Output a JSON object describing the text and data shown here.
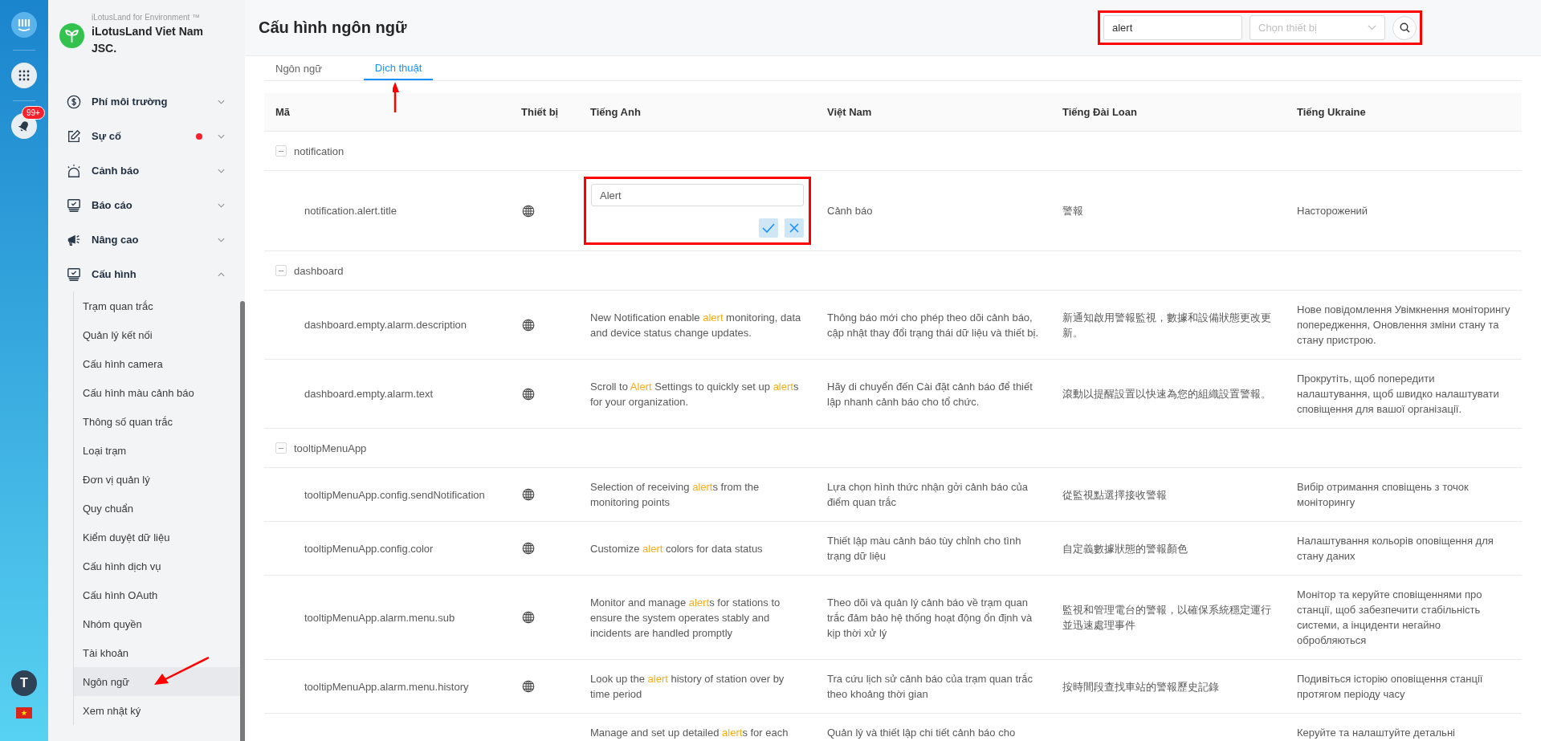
{
  "rail": {
    "notification_count": "99+",
    "avatar_letter": "T"
  },
  "brand": {
    "tagline": "iLotusLand for Environment ™",
    "name": "iLotusLand Viet Nam JSC."
  },
  "sidebar": {
    "items": [
      {
        "label": "Phí môi trường",
        "expanded": false,
        "has_alert": false
      },
      {
        "label": "Sự cố",
        "expanded": false,
        "has_alert": true
      },
      {
        "label": "Cảnh báo",
        "expanded": false,
        "has_alert": false
      },
      {
        "label": "Báo cáo",
        "expanded": false,
        "has_alert": false
      },
      {
        "label": "Nâng cao",
        "expanded": false,
        "has_alert": false
      },
      {
        "label": "Cấu hình",
        "expanded": true,
        "has_alert": false,
        "children": [
          {
            "label": "Trạm quan trắc",
            "selected": false,
            "annotated": false
          },
          {
            "label": "Quản lý kết nối",
            "selected": false,
            "annotated": false
          },
          {
            "label": "Cấu hình camera",
            "selected": false,
            "annotated": false
          },
          {
            "label": "Cấu hình màu cảnh báo",
            "selected": false,
            "annotated": false
          },
          {
            "label": "Thông số quan trắc",
            "selected": false,
            "annotated": false
          },
          {
            "label": "Loại trạm",
            "selected": false,
            "annotated": false
          },
          {
            "label": "Đơn vị quản lý",
            "selected": false,
            "annotated": false
          },
          {
            "label": "Quy chuẩn",
            "selected": false,
            "annotated": false
          },
          {
            "label": "Kiểm duyệt dữ liệu",
            "selected": false,
            "annotated": false
          },
          {
            "label": "Cấu hình dịch vụ",
            "selected": false,
            "annotated": false
          },
          {
            "label": "Cấu hình OAuth",
            "selected": false,
            "annotated": false
          },
          {
            "label": "Nhóm quyền",
            "selected": false,
            "annotated": false
          },
          {
            "label": "Tài khoản",
            "selected": false,
            "annotated": false
          },
          {
            "label": "Ngôn ngữ",
            "selected": true,
            "annotated": true
          },
          {
            "label": "Xem nhật ký",
            "selected": false,
            "annotated": false
          }
        ]
      }
    ]
  },
  "page": {
    "title": "Cấu hình ngôn ngữ"
  },
  "filters": {
    "annotated": true,
    "search": {
      "value": "alert"
    },
    "device": {
      "placeholder": "Chọn thiết bị"
    }
  },
  "tabs": [
    {
      "label": "Ngôn ngữ",
      "selected": false,
      "annotated": false
    },
    {
      "label": "Dịch thuật",
      "selected": true,
      "annotated": true
    }
  ],
  "table": {
    "columns": [
      "Mã",
      "Thiết bị",
      "Tiếng Anh",
      "Việt Nam",
      "Tiếng Đài Loan",
      "Tiếng Ukraine"
    ],
    "groups": [
      {
        "name": "notification",
        "expanded": true,
        "children": [
          {
            "key": "notification.alert.title",
            "editing": true,
            "annotated": true,
            "value": "Alert",
            "vietnamese": "Cảnh báo",
            "taiwanese": "警報",
            "ukrainian": "Насторожений"
          }
        ]
      },
      {
        "name": "dashboard",
        "expanded": true,
        "children": [
          {
            "key": "dashboard.empty.alarm.description",
            "editing": false,
            "english": [
              {
                "text": "New Notification enable ",
                "highlight": false
              },
              {
                "text": "alert",
                "highlight": true
              },
              {
                "text": " monitoring, data and device status change updates.",
                "highlight": false
              }
            ],
            "vietnamese": "Thông báo mới cho phép theo dõi cảnh báo, cập nhật thay đổi trạng thái dữ liệu và thiết bị.",
            "taiwanese": "新通知啟用警報監視，數據和設備狀態更改更新。",
            "ukrainian": "Нове повідомлення Увімкнення моніторингу попередження, Оновлення зміни стану та стану пристрою."
          },
          {
            "key": "dashboard.empty.alarm.text",
            "editing": false,
            "english": [
              {
                "text": "Scroll to ",
                "highlight": false
              },
              {
                "text": "Alert",
                "highlight": true
              },
              {
                "text": " Settings to quickly set up ",
                "highlight": false
              },
              {
                "text": "alert",
                "highlight": true
              },
              {
                "text": "s for your organization.",
                "highlight": false
              }
            ],
            "vietnamese": "Hãy di chuyển đến Cài đặt cảnh báo để thiết lập nhanh cảnh báo cho tổ chức.",
            "taiwanese": "滾動以提醒設置以快速為您的組織設置警報。",
            "ukrainian": "Прокрутіть, щоб попередити налаштування, щоб швидко налаштувати сповіщення для вашої організації."
          }
        ]
      },
      {
        "name": "tooltipMenuApp",
        "expanded": true,
        "children": [
          {
            "key": "tooltipMenuApp.config.sendNotification",
            "editing": false,
            "english": [
              {
                "text": "Selection of receiving ",
                "highlight": false
              },
              {
                "text": "alert",
                "highlight": true
              },
              {
                "text": "s from the monitoring points",
                "highlight": false
              }
            ],
            "vietnamese": "Lựa chọn hình thức nhận gởi cảnh báo của điểm quan trắc",
            "taiwanese": "從監視點選擇接收警報",
            "ukrainian": "Вибір отримання сповіщень з точок моніторингу"
          },
          {
            "key": "tooltipMenuApp.config.color",
            "editing": false,
            "english": [
              {
                "text": "Customize ",
                "highlight": false
              },
              {
                "text": "alert",
                "highlight": true
              },
              {
                "text": " colors for data status",
                "highlight": false
              }
            ],
            "vietnamese": "Thiết lập màu cảnh báo tùy chỉnh cho tình trạng dữ liệu",
            "taiwanese": "自定義數據狀態的警報顏色",
            "ukrainian": "Налаштування кольорів оповіщення для стану даних"
          },
          {
            "key": "tooltipMenuApp.alarm.menu.sub",
            "editing": false,
            "english": [
              {
                "text": "Monitor and manage ",
                "highlight": false
              },
              {
                "text": "alert",
                "highlight": true
              },
              {
                "text": "s for stations to ensure the system operates stably and incidents are handled promptly",
                "highlight": false
              }
            ],
            "vietnamese": "Theo dõi và quản lý cảnh báo về trạm quan trắc đảm bảo hệ thống hoạt động ổn định và kịp thời xử lý",
            "taiwanese": "監視和管理電台的警報，以確保系統穩定運行並迅速處理事件",
            "ukrainian": "Монітор та керуйте сповіщеннями про станції, щоб забезпечити стабільність системи, а інциденти негайно обробляються"
          },
          {
            "key": "tooltipMenuApp.alarm.menu.history",
            "editing": false,
            "english": [
              {
                "text": "Look up the ",
                "highlight": false
              },
              {
                "text": "alert",
                "highlight": true
              },
              {
                "text": " history of station over by time period",
                "highlight": false
              }
            ],
            "vietnamese": "Tra cứu lịch sử cảnh báo của trạm quan trắc theo khoảng thời gian",
            "taiwanese": "按時間段查找車站的警報歷史記錄",
            "ukrainian": "Подивіться історію оповіщення станції протягом періоду часу"
          },
          {
            "editing": false,
            "english": [
              {
                "text": "Manage and set up detailed ",
                "highlight": false
              },
              {
                "text": "alert",
                "highlight": true
              },
              {
                "text": "s for each",
                "highlight": false
              }
            ],
            "vietnamese": "Quản lý và thiết lập chi tiết cảnh báo cho",
            "ukrainian": "Керуйте та налаштуйте детальні"
          }
        ]
      }
    ]
  }
}
